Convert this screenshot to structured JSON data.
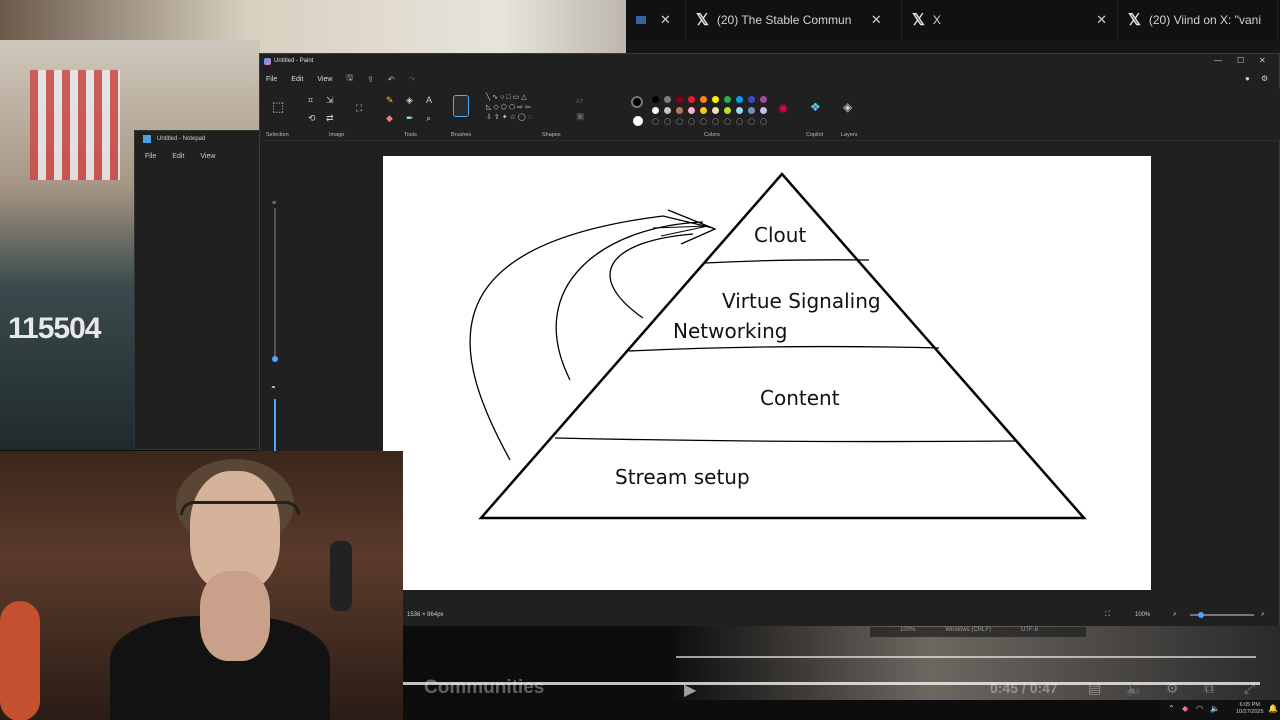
{
  "browser": {
    "tabs": [
      {
        "label": "(20) The Stable Commun",
        "close": "✕"
      },
      {
        "label": "X",
        "close": "✕"
      },
      {
        "label": "(20) Viind on X: \"vani",
        "close": ""
      }
    ]
  },
  "stream": {
    "counter": "115504",
    "video_title": "Communities",
    "video_time": "0:45 / 0:47"
  },
  "notepad": {
    "title": "Untitled - Notepad",
    "menu": [
      "File",
      "Edit",
      "View"
    ]
  },
  "paint": {
    "title": "Untitled - Paint",
    "menu": [
      "File",
      "Edit",
      "View"
    ],
    "ribbon_groups": [
      "Selection",
      "Image",
      "Tools",
      "Brushes",
      "Shapes",
      "Colors",
      "Copilot",
      "Layers"
    ],
    "palette": [
      "#000000",
      "#7f7f7f",
      "#880015",
      "#ed1c24",
      "#ff7f27",
      "#fff200",
      "#22b14c",
      "#00a2e8",
      "#3f48cc",
      "#a349a4",
      "#ffffff",
      "#c3c3c3",
      "#b97a57",
      "#ffaec9",
      "#ffc90e",
      "#efe4b0",
      "#b5e61d",
      "#99d9ea",
      "#7092be",
      "#c8bfe7"
    ],
    "status_dimensions": "1536 × 864px",
    "zoom": "100%",
    "doc_zoom": "100%",
    "line_ending": "Windows (CRLF)",
    "encoding": "UTF-8"
  },
  "pyramid": {
    "levels": [
      "Clout",
      "Virtue Signaling",
      "Networking",
      "Content",
      "Stream setup"
    ]
  },
  "taskbar": {
    "time": "6:05 PM",
    "date": "10/27/2025"
  }
}
